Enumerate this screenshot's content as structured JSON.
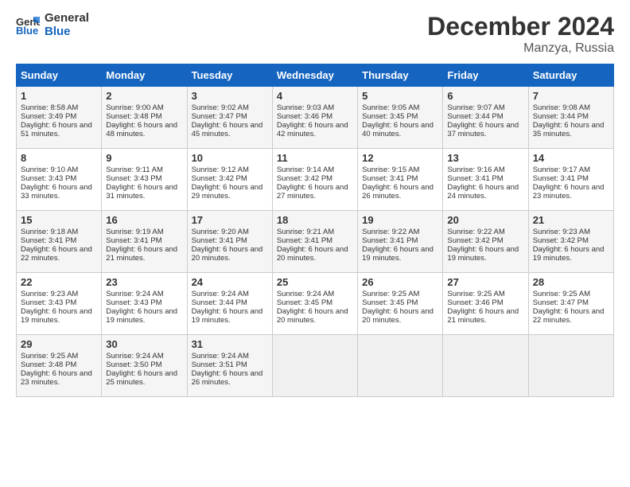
{
  "header": {
    "logo_general": "General",
    "logo_blue": "Blue",
    "month": "December 2024",
    "location": "Manzya, Russia"
  },
  "days_of_week": [
    "Sunday",
    "Monday",
    "Tuesday",
    "Wednesday",
    "Thursday",
    "Friday",
    "Saturday"
  ],
  "weeks": [
    [
      {
        "day": "1",
        "sunrise": "Sunrise: 8:58 AM",
        "sunset": "Sunset: 3:49 PM",
        "daylight": "Daylight: 6 hours and 51 minutes."
      },
      {
        "day": "2",
        "sunrise": "Sunrise: 9:00 AM",
        "sunset": "Sunset: 3:48 PM",
        "daylight": "Daylight: 6 hours and 48 minutes."
      },
      {
        "day": "3",
        "sunrise": "Sunrise: 9:02 AM",
        "sunset": "Sunset: 3:47 PM",
        "daylight": "Daylight: 6 hours and 45 minutes."
      },
      {
        "day": "4",
        "sunrise": "Sunrise: 9:03 AM",
        "sunset": "Sunset: 3:46 PM",
        "daylight": "Daylight: 6 hours and 42 minutes."
      },
      {
        "day": "5",
        "sunrise": "Sunrise: 9:05 AM",
        "sunset": "Sunset: 3:45 PM",
        "daylight": "Daylight: 6 hours and 40 minutes."
      },
      {
        "day": "6",
        "sunrise": "Sunrise: 9:07 AM",
        "sunset": "Sunset: 3:44 PM",
        "daylight": "Daylight: 6 hours and 37 minutes."
      },
      {
        "day": "7",
        "sunrise": "Sunrise: 9:08 AM",
        "sunset": "Sunset: 3:44 PM",
        "daylight": "Daylight: 6 hours and 35 minutes."
      }
    ],
    [
      {
        "day": "8",
        "sunrise": "Sunrise: 9:10 AM",
        "sunset": "Sunset: 3:43 PM",
        "daylight": "Daylight: 6 hours and 33 minutes."
      },
      {
        "day": "9",
        "sunrise": "Sunrise: 9:11 AM",
        "sunset": "Sunset: 3:43 PM",
        "daylight": "Daylight: 6 hours and 31 minutes."
      },
      {
        "day": "10",
        "sunrise": "Sunrise: 9:12 AM",
        "sunset": "Sunset: 3:42 PM",
        "daylight": "Daylight: 6 hours and 29 minutes."
      },
      {
        "day": "11",
        "sunrise": "Sunrise: 9:14 AM",
        "sunset": "Sunset: 3:42 PM",
        "daylight": "Daylight: 6 hours and 27 minutes."
      },
      {
        "day": "12",
        "sunrise": "Sunrise: 9:15 AM",
        "sunset": "Sunset: 3:41 PM",
        "daylight": "Daylight: 6 hours and 26 minutes."
      },
      {
        "day": "13",
        "sunrise": "Sunrise: 9:16 AM",
        "sunset": "Sunset: 3:41 PM",
        "daylight": "Daylight: 6 hours and 24 minutes."
      },
      {
        "day": "14",
        "sunrise": "Sunrise: 9:17 AM",
        "sunset": "Sunset: 3:41 PM",
        "daylight": "Daylight: 6 hours and 23 minutes."
      }
    ],
    [
      {
        "day": "15",
        "sunrise": "Sunrise: 9:18 AM",
        "sunset": "Sunset: 3:41 PM",
        "daylight": "Daylight: 6 hours and 22 minutes."
      },
      {
        "day": "16",
        "sunrise": "Sunrise: 9:19 AM",
        "sunset": "Sunset: 3:41 PM",
        "daylight": "Daylight: 6 hours and 21 minutes."
      },
      {
        "day": "17",
        "sunrise": "Sunrise: 9:20 AM",
        "sunset": "Sunset: 3:41 PM",
        "daylight": "Daylight: 6 hours and 20 minutes."
      },
      {
        "day": "18",
        "sunrise": "Sunrise: 9:21 AM",
        "sunset": "Sunset: 3:41 PM",
        "daylight": "Daylight: 6 hours and 20 minutes."
      },
      {
        "day": "19",
        "sunrise": "Sunrise: 9:22 AM",
        "sunset": "Sunset: 3:41 PM",
        "daylight": "Daylight: 6 hours and 19 minutes."
      },
      {
        "day": "20",
        "sunrise": "Sunrise: 9:22 AM",
        "sunset": "Sunset: 3:42 PM",
        "daylight": "Daylight: 6 hours and 19 minutes."
      },
      {
        "day": "21",
        "sunrise": "Sunrise: 9:23 AM",
        "sunset": "Sunset: 3:42 PM",
        "daylight": "Daylight: 6 hours and 19 minutes."
      }
    ],
    [
      {
        "day": "22",
        "sunrise": "Sunrise: 9:23 AM",
        "sunset": "Sunset: 3:43 PM",
        "daylight": "Daylight: 6 hours and 19 minutes."
      },
      {
        "day": "23",
        "sunrise": "Sunrise: 9:24 AM",
        "sunset": "Sunset: 3:43 PM",
        "daylight": "Daylight: 6 hours and 19 minutes."
      },
      {
        "day": "24",
        "sunrise": "Sunrise: 9:24 AM",
        "sunset": "Sunset: 3:44 PM",
        "daylight": "Daylight: 6 hours and 19 minutes."
      },
      {
        "day": "25",
        "sunrise": "Sunrise: 9:24 AM",
        "sunset": "Sunset: 3:45 PM",
        "daylight": "Daylight: 6 hours and 20 minutes."
      },
      {
        "day": "26",
        "sunrise": "Sunrise: 9:25 AM",
        "sunset": "Sunset: 3:45 PM",
        "daylight": "Daylight: 6 hours and 20 minutes."
      },
      {
        "day": "27",
        "sunrise": "Sunrise: 9:25 AM",
        "sunset": "Sunset: 3:46 PM",
        "daylight": "Daylight: 6 hours and 21 minutes."
      },
      {
        "day": "28",
        "sunrise": "Sunrise: 9:25 AM",
        "sunset": "Sunset: 3:47 PM",
        "daylight": "Daylight: 6 hours and 22 minutes."
      }
    ],
    [
      {
        "day": "29",
        "sunrise": "Sunrise: 9:25 AM",
        "sunset": "Sunset: 3:48 PM",
        "daylight": "Daylight: 6 hours and 23 minutes."
      },
      {
        "day": "30",
        "sunrise": "Sunrise: 9:24 AM",
        "sunset": "Sunset: 3:50 PM",
        "daylight": "Daylight: 6 hours and 25 minutes."
      },
      {
        "day": "31",
        "sunrise": "Sunrise: 9:24 AM",
        "sunset": "Sunset: 3:51 PM",
        "daylight": "Daylight: 6 hours and 26 minutes."
      },
      null,
      null,
      null,
      null
    ]
  ]
}
